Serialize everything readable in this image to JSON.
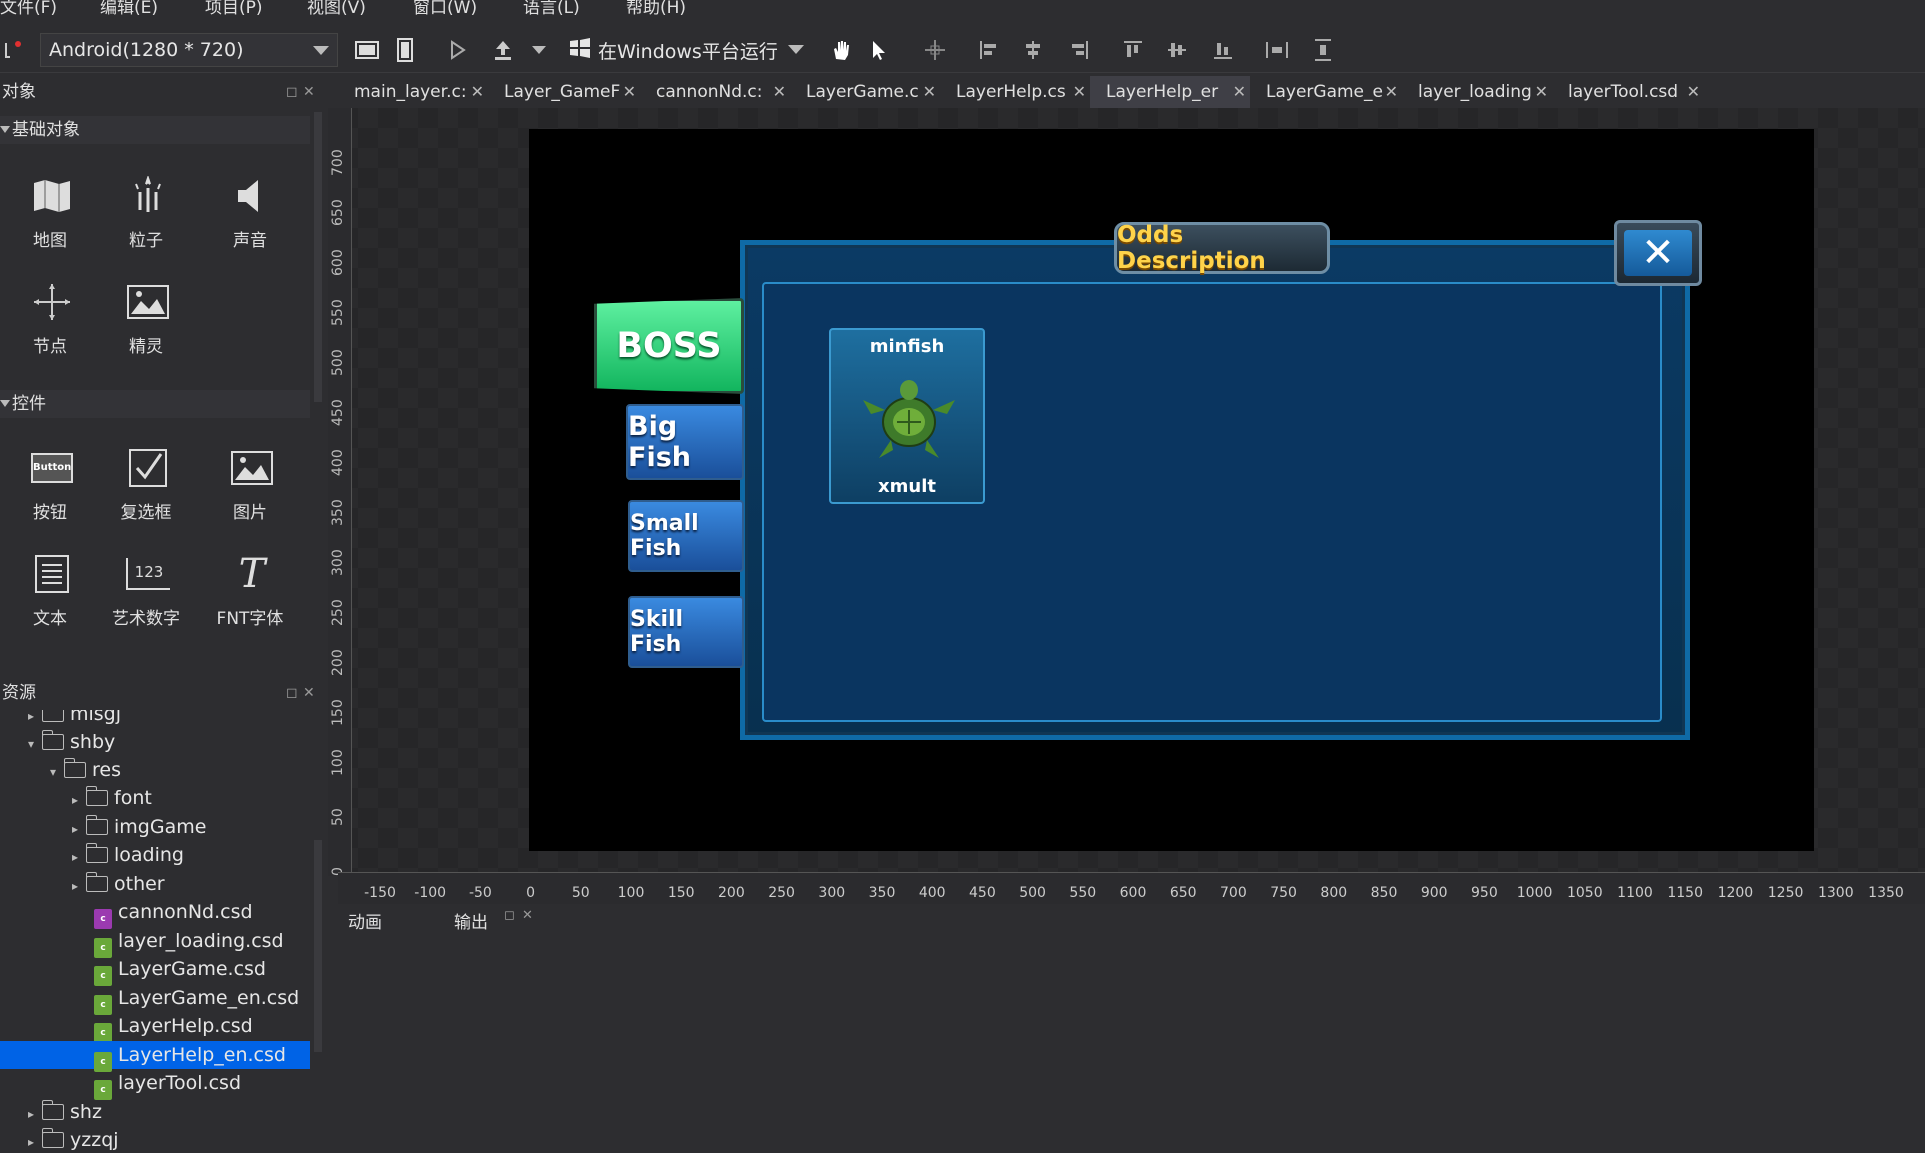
{
  "menubar": [
    "文件(F)",
    "编辑(E)",
    "项目(P)",
    "视图(V)",
    "窗口(W)",
    "语言(L)",
    "帮助(H)"
  ],
  "toolbar": {
    "device": "Android(1280 * 720)",
    "run_label": "在Windows平台运行"
  },
  "objects_panel": {
    "title": "对象",
    "sections": {
      "basic": "基础对象",
      "controls": "控件"
    },
    "basic_items": [
      "地图",
      "粒子",
      "声音",
      "节点",
      "精灵"
    ],
    "control_items": [
      "按钮",
      "复选框",
      "图片",
      "文本",
      "艺术数字",
      "FNT字体"
    ],
    "button_icon_text": "Button",
    "atlas_icon_text": "123"
  },
  "resources_panel": {
    "title": "资源",
    "tree": [
      {
        "label": "misgj"
      },
      {
        "label": "shby"
      },
      {
        "label": "res"
      },
      {
        "label": "font"
      },
      {
        "label": "imgGame"
      },
      {
        "label": "loading"
      },
      {
        "label": "other"
      },
      {
        "label": "cannonNd.csd"
      },
      {
        "label": "layer_loading.csd"
      },
      {
        "label": "LayerGame.csd"
      },
      {
        "label": "LayerGame_en.csd"
      },
      {
        "label": "LayerHelp.csd"
      },
      {
        "label": "LayerHelp_en.csd"
      },
      {
        "label": "layerTool.csd"
      },
      {
        "label": "shz"
      },
      {
        "label": "yzzqj"
      }
    ],
    "selected": "LayerHelp_en.csd"
  },
  "tabs": [
    "main_layer.c:",
    "Layer_GameF",
    "cannonNd.c:",
    "LayerGame.c",
    "LayerHelp.cs",
    "LayerHelp_er",
    "LayerGame_e",
    "layer_loading",
    "layerTool.csd"
  ],
  "active_tab": "LayerHelp_er",
  "ruler": {
    "v": [
      "700",
      "650",
      "600",
      "550",
      "500",
      "450",
      "400",
      "350",
      "300",
      "250",
      "200",
      "150",
      "100",
      "50",
      "0"
    ],
    "h": [
      "-150",
      "-100",
      "-50",
      "0",
      "50",
      "100",
      "150",
      "200",
      "250",
      "300",
      "350",
      "400",
      "450",
      "500",
      "550",
      "600",
      "650",
      "700",
      "750",
      "800",
      "850",
      "900",
      "950",
      "1000",
      "1050",
      "1100",
      "1150",
      "1200",
      "1250",
      "1300",
      "1350"
    ]
  },
  "dialog": {
    "title": "Odds Description",
    "close": "✕",
    "buttons": [
      "BOSS",
      "Big Fish",
      "Small Fish",
      "Skill Fish"
    ],
    "card": {
      "name": "minfish",
      "mult": "xmult"
    }
  },
  "bottom": {
    "tabs": [
      "动画",
      "输出"
    ]
  },
  "colors": {
    "accent": "#0063e6",
    "boss_green": "#12b55e",
    "title_gold": "#ffd34a"
  }
}
